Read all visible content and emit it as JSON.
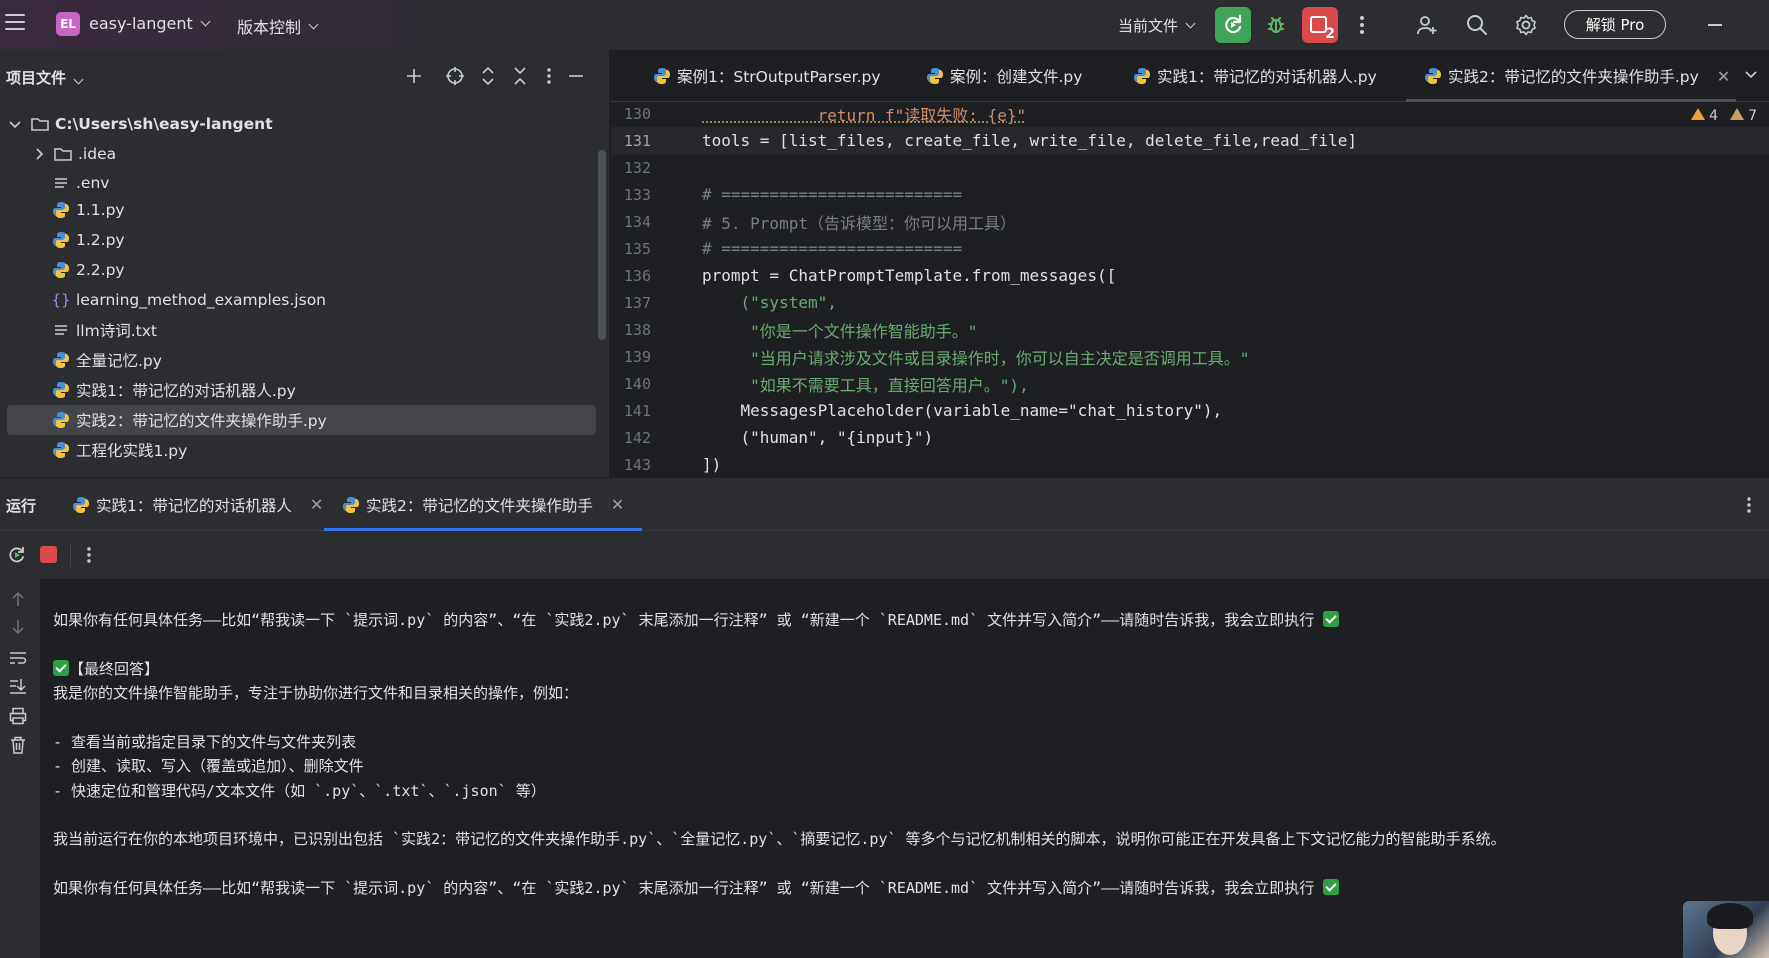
{
  "titlebar": {
    "project_badge": "EL",
    "project_name": "easy-langent",
    "vcs_label": "版本控制",
    "run_config": "当前文件",
    "unlock_label": "解锁 Pro",
    "notification_count": "2",
    "accent_colors": {
      "run": "#3fa45a",
      "stop": "#db4a4a",
      "badge": "#c765c2"
    }
  },
  "project_panel": {
    "title": "项目文件",
    "root": "C:\\Users\\sh\\easy-langent",
    "items": [
      {
        "label": ".idea",
        "icon": "folder-icon"
      },
      {
        "label": ".env",
        "icon": "text-file-icon"
      },
      {
        "label": "1.1.py",
        "icon": "python-icon"
      },
      {
        "label": "1.2.py",
        "icon": "python-icon"
      },
      {
        "label": "2.2.py",
        "icon": "python-icon"
      },
      {
        "label": "learning_method_examples.json",
        "icon": "json-icon"
      },
      {
        "label": "llm诗词.txt",
        "icon": "text-file-icon"
      },
      {
        "label": "全量记忆.py",
        "icon": "python-icon"
      },
      {
        "label": "实践1：带记忆的对话机器人.py",
        "icon": "python-icon"
      },
      {
        "label": "实践2：带记忆的文件夹操作助手.py",
        "icon": "python-icon",
        "selected": true
      },
      {
        "label": "工程化实践1.py",
        "icon": "python-icon"
      }
    ]
  },
  "editor": {
    "tabs": [
      {
        "label": "案例1：StrOutputParser.py"
      },
      {
        "label": "案例：创建文件.py"
      },
      {
        "label": "实践1：带记忆的对话机器人.py"
      },
      {
        "label": "实践2：带记忆的文件夹操作助手.py",
        "active": true
      }
    ],
    "warnings": {
      "errors_count": "4",
      "warnings_count": "7"
    },
    "current_line": "131",
    "lines": [
      {
        "n": "130",
        "text": "            return f\"读取失败: {e}\""
      },
      {
        "n": "131",
        "text": "tools = [list_files, create_file, write_file, delete_file,read_file]"
      },
      {
        "n": "132",
        "text": ""
      },
      {
        "n": "133",
        "text": "# ========================="
      },
      {
        "n": "134",
        "text": "# 5. Prompt（告诉模型：你可以用工具）"
      },
      {
        "n": "135",
        "text": "# ========================="
      },
      {
        "n": "136",
        "text": "prompt = ChatPromptTemplate.from_messages(["
      },
      {
        "n": "137",
        "text": "    (\"system\","
      },
      {
        "n": "138",
        "text": "     \"你是一个文件操作智能助手。\""
      },
      {
        "n": "139",
        "text": "     \"当用户请求涉及文件或目录操作时，你可以自主决定是否调用工具。\""
      },
      {
        "n": "140",
        "text": "     \"如果不需要工具，直接回答用户。\"),"
      },
      {
        "n": "141",
        "text": "    MessagesPlaceholder(variable_name=\"chat_history\"),"
      },
      {
        "n": "142",
        "text": "    (\"human\", \"{input}\")"
      },
      {
        "n": "143",
        "text": "])"
      }
    ]
  },
  "run_panel": {
    "title": "运行",
    "tabs": [
      {
        "label": "实践1：带记忆的对话机器人"
      },
      {
        "label": "实践2：带记忆的文件夹操作助手",
        "active": true
      }
    ],
    "console": {
      "line1": "如果你有任何具体任务——比如“帮我读一下 `提示词.py` 的内容”、“在 `实践2.py` 末尾添加一行注释” 或 “新建一个 `README.md` 文件并写入简介”——请随时告诉我，我会立即执行 ",
      "final_answer": "【最终回答】",
      "intro": "我是你的文件操作智能助手，专注于协助你进行文件和目录相关的操作，例如：",
      "bullets": [
        "- 查看当前或指定目录下的文件与文件夹列表",
        "- 创建、读取、写入（覆盖或追加）、删除文件",
        "- 快速定位和管理代码/文本文件（如 `.py`、`.txt`、`.json` 等）"
      ],
      "env": "我当前运行在你的本地项目环境中，已识别出包括 `实践2：带记忆的文件夹操作助手.py`、`全量记忆.py`、`摘要记忆.py` 等多个与记忆机制相关的脚本，说明你可能正在开发具备上下文记忆能力的智能助手系统。",
      "line_last": "如果你有任何具体任务——比如“帮我读一下 `提示词.py` 的内容”、“在 `实践2.py` 末尾添加一行注释” 或 “新建一个 `README.md` 文件并写入简介”——请随时告诉我，我会立即执行 "
    }
  }
}
